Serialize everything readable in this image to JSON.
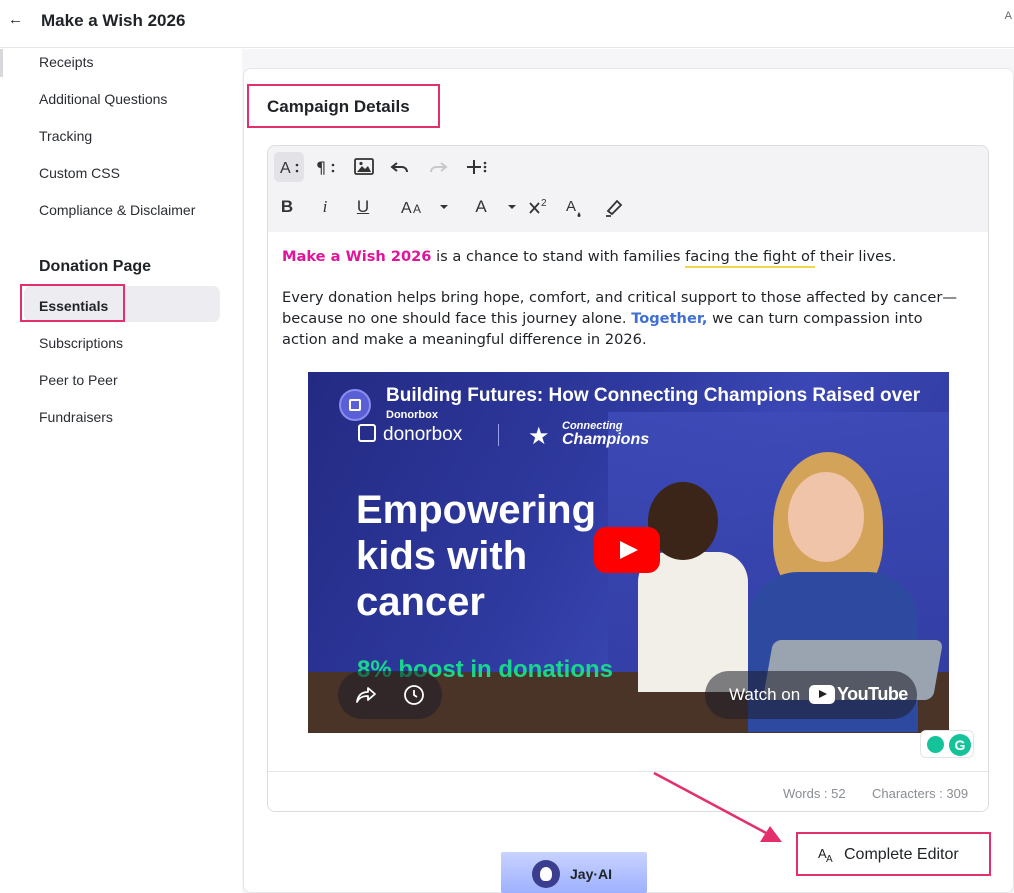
{
  "header": {
    "title": "Make a Wish 2026",
    "back_icon": "←",
    "corner_mark": "A"
  },
  "sidebar": {
    "items_top": [
      {
        "label": "Receipts"
      },
      {
        "label": "Additional Questions"
      },
      {
        "label": "Tracking"
      },
      {
        "label": "Custom CSS"
      },
      {
        "label": "Compliance & Disclaimer"
      }
    ],
    "section_heading": "Donation Page",
    "items_bottom": [
      {
        "label": "Essentials",
        "active": true
      },
      {
        "label": "Subscriptions"
      },
      {
        "label": "Peer to Peer"
      },
      {
        "label": "Fundraisers"
      }
    ]
  },
  "main": {
    "section_title": "Campaign Details",
    "toolbar": {
      "row1": [
        "font-style-icon",
        "paragraph-format-icon",
        "insert-image-icon",
        "undo-icon",
        "redo-icon",
        "more-insert-icon"
      ],
      "row2": [
        "bold-icon",
        "italic-icon",
        "underline-icon",
        "font-size-icon",
        "font-size-dropdown-icon",
        "font-family-icon",
        "font-family-dropdown-icon",
        "superscript-icon",
        "text-color-icon",
        "highlight-icon"
      ]
    },
    "content": {
      "p1_brand": "Make a Wish 2026",
      "p1_text_a": " is a chance to stand with families ",
      "p1_underlined": "facing the fight of",
      "p1_text_b": " their lives.",
      "p2_text_a": "Every donation helps bring hope, comfort, and critical support to those affected by cancer—because no one should face this journey alone. ",
      "p2_blue": "Together,",
      "p2_text_b": " we can turn compassion into action and make a meaningful difference in 2026."
    },
    "video": {
      "title": "Building Futures: How Connecting Champions Raised over",
      "channel": "Donorbox",
      "donorbox_logo": "donorbox",
      "partner_small": "Connecting",
      "partner_big": "Champions",
      "headline": "Empowering kids with cancer",
      "boost": "8% boost in donations",
      "watch_label": "Watch on",
      "youtube_label": "YouTube"
    },
    "status": {
      "words": "Words : 52",
      "characters": "Characters : 309"
    }
  },
  "footer": {
    "jay_ai_label": "Jay·AI",
    "complete_editor_label": "Complete Editor"
  },
  "colors": {
    "highlight": "#e3306c",
    "brand": "#e1149c",
    "link_blue": "#3f6fd1",
    "boost_green": "#19d68c"
  }
}
